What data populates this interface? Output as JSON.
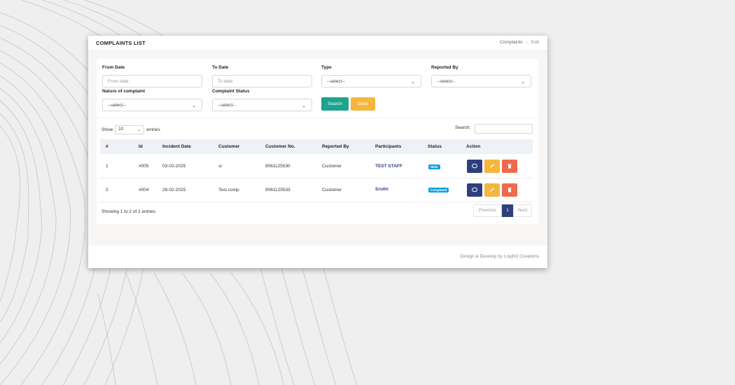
{
  "header": {
    "title": "COMPLAINTS LIST",
    "breadcrumb": [
      "Complaints",
      "Edit"
    ]
  },
  "filters": {
    "from_date": {
      "label": "From Date",
      "placeholder": "From date"
    },
    "to_date": {
      "label": "To Date",
      "placeholder": "To date"
    },
    "type": {
      "label": "Type",
      "value": "--select--"
    },
    "reported_by": {
      "label": "Reported By",
      "value": "--select--"
    },
    "nature": {
      "label": "Nature of complaint",
      "value": "--select--"
    },
    "status": {
      "label": "Complaint Status",
      "value": "--select--"
    },
    "search_label": "Search",
    "clear_label": "Clear"
  },
  "table": {
    "show_label": "Show",
    "entries_value": "10",
    "entries_label": "entries",
    "search_label": "Search:",
    "columns": [
      "#",
      "Id",
      "Incident Date",
      "Customer",
      "Customer No.",
      "Reported By",
      "Participants",
      "Status",
      "Action"
    ],
    "rows": [
      {
        "num": "1",
        "id": "#005",
        "date": "03-03-2025",
        "customer": "sr",
        "customer_no": "9061125530",
        "reported_by": "Customer",
        "participants": "TEST STAFF",
        "status": "NEW",
        "status_color": "#0c9fe8"
      },
      {
        "num": "2",
        "id": "#004",
        "date": "28-02-2025",
        "customer": "Test comp",
        "customer_no": "9061125533",
        "reported_by": "Customer",
        "participants": "Sruthi",
        "status": "Completed",
        "status_color": "#0c9fe8"
      }
    ],
    "showing_text": "Showing 1 to 2 of 2 entries",
    "pagination": {
      "prev": "Previous",
      "current": "1",
      "next": "Next"
    }
  },
  "footer": {
    "text": "Design & Develop by LogiN2 Creations"
  },
  "colors": {
    "primary": "#2f3f7e",
    "success": "#1ca48f",
    "warning": "#f5b63f",
    "danger": "#ee6a4c"
  },
  "icons": {
    "view": "eye-icon",
    "edit": "pencil-icon",
    "delete": "trash-icon",
    "dropdown": "chevron-down-icon"
  }
}
